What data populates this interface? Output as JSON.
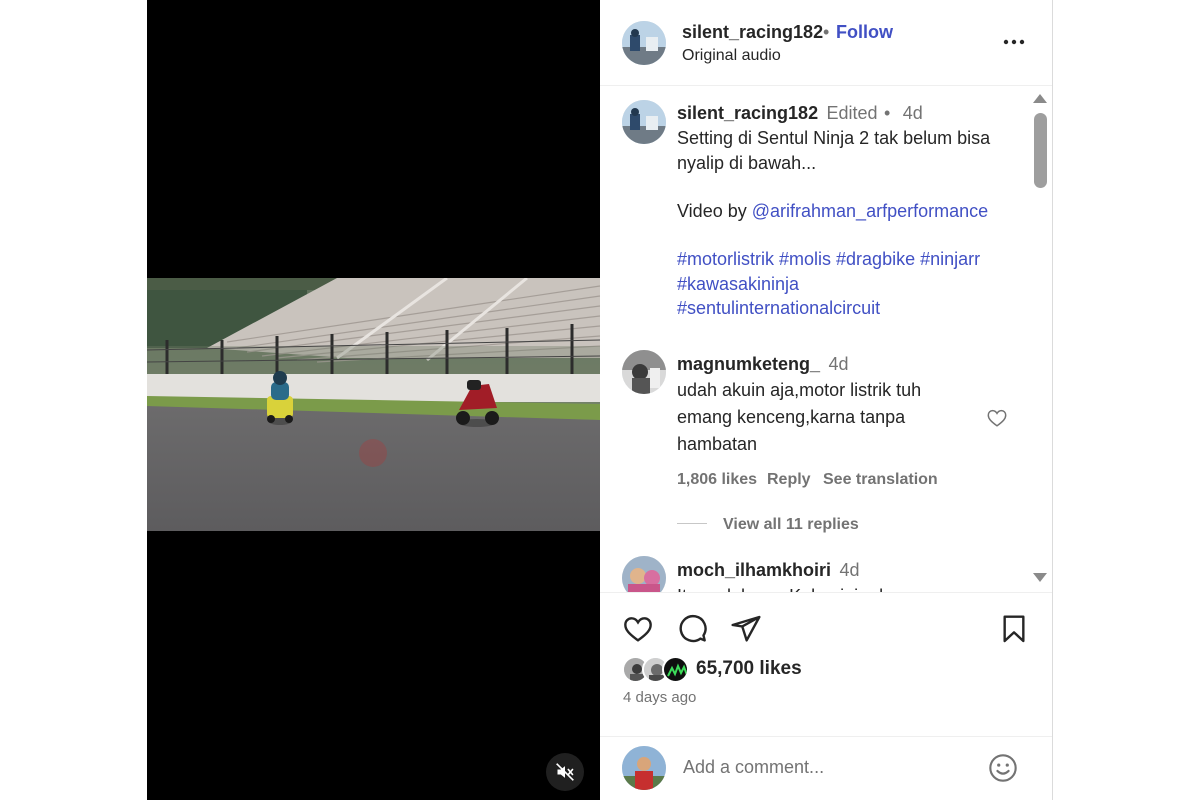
{
  "post": {
    "username": "silent_racing182",
    "follow_label": "Follow",
    "separator": "•",
    "audio": "Original audio"
  },
  "caption": {
    "username": "silent_racing182",
    "edited": "Edited",
    "separator": "•",
    "age": "4d",
    "line1": "Setting di Sentul Ninja 2 tak belum bisa",
    "line2": "nyalip di bawah...",
    "video_by": "Video by",
    "mention": "@arifrahman_arfperformance",
    "hashtags_line1": "#motorlistrik #molis #dragbike #ninjarr",
    "hashtags_line2": "#kawasakininja",
    "hashtags_line3": "#sentulinternationalcircuit"
  },
  "comments": [
    {
      "username": "magnumketeng_",
      "age": "4d",
      "line1": "udah akuin aja,motor listrik tuh",
      "line2": "emang kenceng,karna tanpa",
      "line3": "hambatan",
      "likes": "1,806 likes",
      "reply": "Reply",
      "translate": "See translation",
      "view_replies": "View all 11 replies"
    },
    {
      "username": "moch_ilhamkhoiri",
      "age": "4d",
      "partial_text": "Itu sadah sus Kalau ini ada"
    }
  ],
  "actions": {
    "likes_count": "65,700 likes",
    "time_ago": "4 days ago",
    "comment_placeholder": "Add a comment..."
  },
  "colors": {
    "accent": "#4150c4",
    "text": "#262626",
    "muted": "#737373",
    "border": "#dbdbdb"
  },
  "icons": [
    "more-options-icon",
    "heart-icon",
    "comment-icon",
    "share-icon",
    "bookmark-icon",
    "emoji-icon",
    "mute-icon"
  ]
}
